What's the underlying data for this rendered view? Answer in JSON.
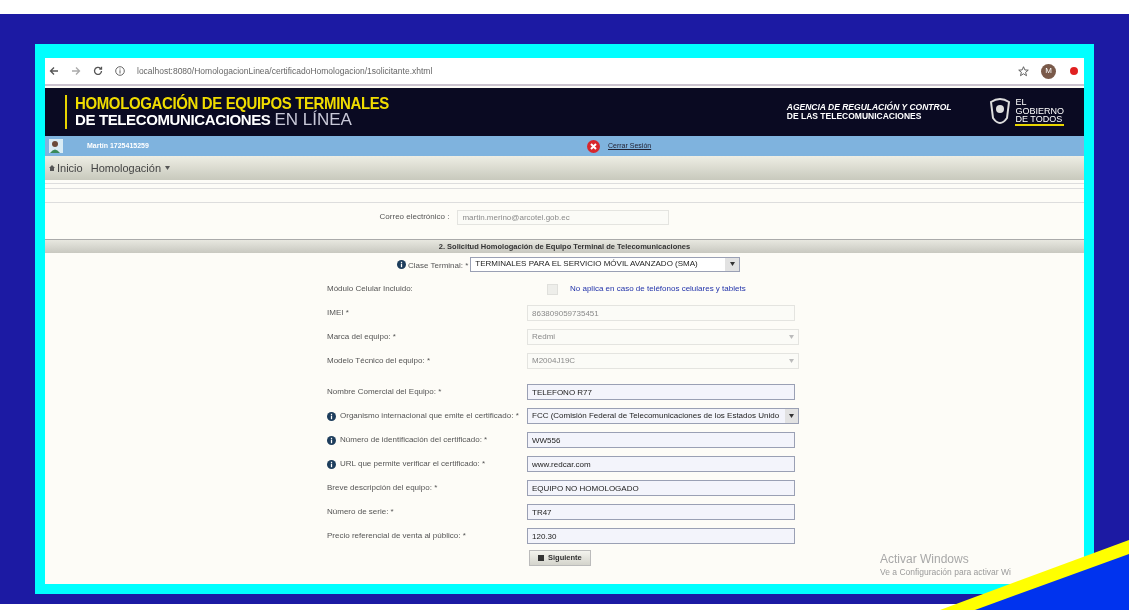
{
  "browser": {
    "url": "localhost:8080/HomologacionLinea/certificadoHomologacion/1solicitante.xhtml",
    "profile_initial": "M"
  },
  "banner": {
    "title_line1": "HOMOLOGACIÓN DE EQUIPOS TERMINALES",
    "title_line2": "DE TELECOMUNICACIONES",
    "title_suffix": "EN LÍNEA",
    "agency_line1": "AGENCIA DE REGULACIÓN Y CONTROL",
    "agency_line2": "DE LAS TELECOMUNICACIONES",
    "gov_line1": "EL",
    "gov_line2": "GOBIERNO",
    "gov_line3": "DE TODOS"
  },
  "user_bar": {
    "user": "Martín 1725415259",
    "logout": "Cerrar Sesión"
  },
  "nav": [
    {
      "label": "Inicio",
      "kind": "home"
    },
    {
      "label": "Homologación",
      "kind": "dropdown"
    }
  ],
  "email": {
    "label": "Correo electrónico :",
    "value": "martin.merino@arcotel.gob.ec"
  },
  "section_title": "2. Solicitud Homologación de Equipo Terminal de Telecomunicaciones",
  "clase_terminal": {
    "label": "Clase Terminal: *",
    "value": "TERMINALES PARA EL SERVICIO MÓVIL AVANZADO (SMA)",
    "info": true
  },
  "device_fields": [
    {
      "kind": "checkbox",
      "label": "Módulo Celular Incluido:",
      "checked": false,
      "disabled": true,
      "note": "No aplica en caso de teléfonos celulares y tablets",
      "info": false
    },
    {
      "kind": "text",
      "label": "IMEI *",
      "value": "863809059735451",
      "disabled": true,
      "info": false
    },
    {
      "kind": "select",
      "label": "Marca del equipo: *",
      "value": "Redmi",
      "disabled": true,
      "info": false
    },
    {
      "kind": "select",
      "label": "Modelo Técnico del equipo: *",
      "value": "M2004J19C",
      "disabled": true,
      "info": false
    }
  ],
  "certificate_fields": [
    {
      "kind": "text",
      "label": "Nombre Comercial del Equipo: *",
      "value": "TELEFONO R77",
      "disabled": false,
      "info": false
    },
    {
      "kind": "select",
      "label": "Organismo internacional que emite el certificado: *",
      "value": "FCC (Comisión Federal de Telecomunicaciones de los Estados Unido",
      "disabled": false,
      "info": true
    },
    {
      "kind": "text",
      "label": "Número de identificación del certificado: *",
      "value": "WW556",
      "disabled": false,
      "info": true
    },
    {
      "kind": "text",
      "label": "URL que permite verificar el certificado: *",
      "value": "www.redcar.com",
      "disabled": false,
      "info": true
    },
    {
      "kind": "text",
      "label": "Breve descripción del equipo: *",
      "value": "EQUIPO NO HOMOLOGADO",
      "disabled": false,
      "info": false
    },
    {
      "kind": "text",
      "label": "Número de serie: *",
      "value": "TR47",
      "disabled": false,
      "info": false
    },
    {
      "kind": "text",
      "label": "Precio referencial de venta al público: *",
      "value": "120.30",
      "disabled": false,
      "info": false
    }
  ],
  "submit": "Siguiente",
  "os_notice": {
    "title": "Activar Windows",
    "text": "Ve a Configuración para activar Wi"
  }
}
